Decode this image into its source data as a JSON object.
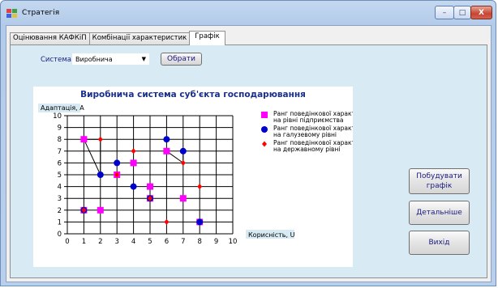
{
  "window": {
    "title": "Стратегія",
    "controls": {
      "minimize": "–",
      "maximize": "□",
      "close": "X"
    }
  },
  "tabs": [
    {
      "label": "Оцінювання КАФКіП",
      "active": false
    },
    {
      "label": "Комбінації характеристик",
      "active": false
    },
    {
      "label": "Графік",
      "active": true
    }
  ],
  "controls": {
    "system_label": "Система",
    "system_value": "Виробнича",
    "choose_button": "Обрати",
    "build_button": "Побудувати графік",
    "details_button": "Детальніше",
    "exit_button": "Вихід"
  },
  "chart_data": {
    "type": "scatter",
    "title": "Виробнича система суб'єкта господарювання",
    "xlabel": "Корисність, U",
    "ylabel": "Адаптація, A",
    "xlim": [
      0,
      10
    ],
    "ylim": [
      0,
      10
    ],
    "x_ticks": [
      0,
      1,
      2,
      3,
      4,
      5,
      6,
      7,
      8,
      9,
      10
    ],
    "y_ticks": [
      0,
      1,
      2,
      3,
      4,
      5,
      6,
      7,
      8,
      9,
      10
    ],
    "grid": true,
    "legend_position": "right",
    "series": [
      {
        "name": "Ранг поведінкової характеристики на рівні підприємства",
        "marker": "square",
        "color": "#ff00ff",
        "points": [
          [
            1,
            8
          ],
          [
            1,
            2
          ],
          [
            2,
            2
          ],
          [
            3,
            5
          ],
          [
            4,
            6
          ],
          [
            5,
            4
          ],
          [
            5,
            3
          ],
          [
            6,
            7
          ],
          [
            7,
            3
          ],
          [
            8,
            1
          ]
        ]
      },
      {
        "name": "Ранг поведінкової характеристики на галузевому рівні",
        "marker": "circle",
        "color": "#0000cc",
        "points": [
          [
            1,
            2
          ],
          [
            2,
            5
          ],
          [
            3,
            6
          ],
          [
            4,
            4
          ],
          [
            5,
            3
          ],
          [
            6,
            8
          ],
          [
            7,
            7
          ],
          [
            8,
            1
          ]
        ]
      },
      {
        "name": "Ранг поведінкової характеристики на державному рівні",
        "marker": "diamond",
        "color": "#ff0000",
        "points": [
          [
            1,
            2
          ],
          [
            2,
            8
          ],
          [
            3,
            5
          ],
          [
            4,
            7
          ],
          [
            5,
            3
          ],
          [
            6,
            1
          ],
          [
            7,
            6
          ],
          [
            8,
            4
          ]
        ]
      }
    ],
    "connector_lines": [
      [
        [
          1,
          8
        ],
        [
          2,
          5
        ]
      ],
      [
        [
          1,
          8
        ],
        [
          2,
          8
        ]
      ],
      [
        [
          2,
          8
        ],
        [
          2,
          5
        ]
      ],
      [
        [
          6,
          7
        ],
        [
          7,
          6
        ]
      ],
      [
        [
          7,
          7
        ],
        [
          7,
          6
        ]
      ]
    ]
  }
}
